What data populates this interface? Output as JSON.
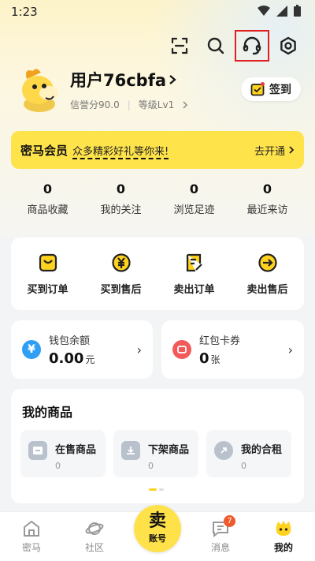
{
  "status_bar": {
    "time": "1:23"
  },
  "top_actions": {
    "scan": "scan-icon",
    "search": "search-icon",
    "service": "headset-icon",
    "settings": "settings-icon"
  },
  "profile": {
    "username": "用户76cbfa",
    "credit": "信誉分90.0",
    "level": "等级Lv1",
    "checkin_label": "签到"
  },
  "vip": {
    "title": "密马会员",
    "subtitle": "众多精彩好礼等你来!",
    "action": "去开通"
  },
  "stats": [
    {
      "num": "0",
      "label": "商品收藏"
    },
    {
      "num": "0",
      "label": "我的关注"
    },
    {
      "num": "0",
      "label": "浏览足迹"
    },
    {
      "num": "0",
      "label": "最近来访"
    }
  ],
  "orders": [
    {
      "label": "买到订单",
      "icon": "bag-icon"
    },
    {
      "label": "买到售后",
      "icon": "yen-icon"
    },
    {
      "label": "卖出订单",
      "icon": "edit-list-icon"
    },
    {
      "label": "卖出售后",
      "icon": "arrow-circle-icon"
    }
  ],
  "wallet": {
    "title": "钱包余额",
    "value": "0.00",
    "unit": "元"
  },
  "coupon": {
    "title": "红包卡券",
    "value": "0",
    "unit": "张"
  },
  "goods": {
    "title": "我的商品",
    "items": [
      {
        "label": "在售商品",
        "count": "0"
      },
      {
        "label": "下架商品",
        "count": "0"
      },
      {
        "label": "我的合租",
        "count": "0"
      }
    ]
  },
  "bottom_nav": {
    "items": [
      {
        "label": "密马"
      },
      {
        "label": "社区"
      },
      {
        "label": ""
      },
      {
        "label": "消息",
        "badge": "7"
      },
      {
        "label": "我的"
      }
    ],
    "sell_main": "卖",
    "sell_sub": "账号"
  },
  "colors": {
    "accent": "#ffe34a",
    "badge": "#f05a2a",
    "highlight": "#e02020"
  }
}
